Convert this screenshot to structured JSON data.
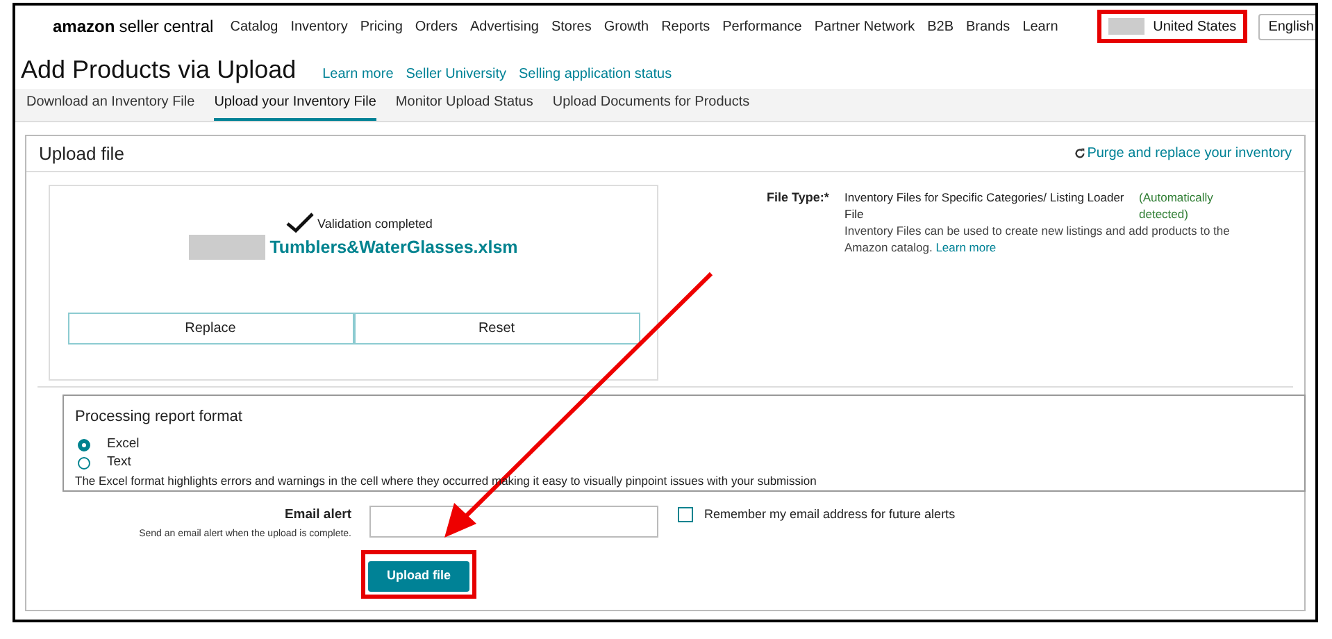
{
  "nav": {
    "logo_brand": "amazon",
    "logo_product": "seller central",
    "items": [
      "Catalog",
      "Inventory",
      "Pricing",
      "Orders",
      "Advertising",
      "Stores",
      "Growth",
      "Reports",
      "Performance",
      "Partner Network",
      "B2B",
      "Brands",
      "Learn"
    ],
    "account": {
      "country": "United States"
    },
    "language_button": "English"
  },
  "page": {
    "title": "Add Products via Upload",
    "links": [
      "Learn more",
      "Seller University",
      "Selling application status"
    ]
  },
  "tabs": [
    {
      "label": "Download an Inventory File",
      "selected": false
    },
    {
      "label": "Upload your Inventory File",
      "selected": true
    },
    {
      "label": "Monitor Upload Status",
      "selected": false
    },
    {
      "label": "Upload Documents for Products",
      "selected": false
    }
  ],
  "upload_panel": {
    "title": "Upload file",
    "purge_link": "Purge and replace your inventory",
    "file": {
      "status": "Validation completed",
      "name": "Tumblers&WaterGlasses.xlsm"
    },
    "buttons": [
      "Replace",
      "Reset"
    ],
    "file_type": {
      "label": "File Type:*",
      "value": "Inventory Files for Specific Categories/ Listing Loader File",
      "detection": "(Automatically detected)",
      "description": "Inventory Files can be used to create new listings and add products to the Amazon catalog.",
      "link": "Learn more"
    }
  },
  "report_format": {
    "title": "Processing report format",
    "options": [
      {
        "label": "Excel",
        "selected": true
      },
      {
        "label": "Text",
        "selected": false
      }
    ],
    "note": "The Excel format highlights errors and warnings in the cell where they occurred making it easy to visually pinpoint issues with your submission"
  },
  "email_alert": {
    "label": "Email alert",
    "hint": "Send an email alert when the upload is complete.",
    "remember": {
      "label": "Remember my email address for future alerts",
      "checked": false
    }
  },
  "submit_button": "Upload file"
}
